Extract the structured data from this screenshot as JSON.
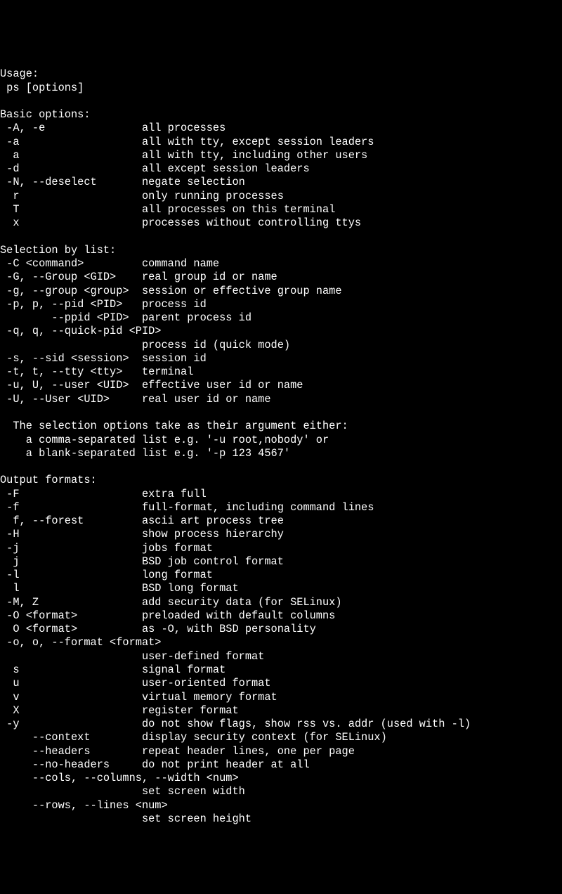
{
  "lines": [
    "Usage:",
    " ps [options]",
    "",
    "Basic options:",
    " -A, -e               all processes",
    " -a                   all with tty, except session leaders",
    "  a                   all with tty, including other users",
    " -d                   all except session leaders",
    " -N, --deselect       negate selection",
    "  r                   only running processes",
    "  T                   all processes on this terminal",
    "  x                   processes without controlling ttys",
    "",
    "Selection by list:",
    " -C <command>         command name",
    " -G, --Group <GID>    real group id or name",
    " -g, --group <group>  session or effective group name",
    " -p, p, --pid <PID>   process id",
    "        --ppid <PID>  parent process id",
    " -q, q, --quick-pid <PID>",
    "                      process id (quick mode)",
    " -s, --sid <session>  session id",
    " -t, t, --tty <tty>   terminal",
    " -u, U, --user <UID>  effective user id or name",
    " -U, --User <UID>     real user id or name",
    "",
    "  The selection options take as their argument either:",
    "    a comma-separated list e.g. '-u root,nobody' or",
    "    a blank-separated list e.g. '-p 123 4567'",
    "",
    "Output formats:",
    " -F                   extra full",
    " -f                   full-format, including command lines",
    "  f, --forest         ascii art process tree",
    " -H                   show process hierarchy",
    " -j                   jobs format",
    "  j                   BSD job control format",
    " -l                   long format",
    "  l                   BSD long format",
    " -M, Z                add security data (for SELinux)",
    " -O <format>          preloaded with default columns",
    "  O <format>          as -O, with BSD personality",
    " -o, o, --format <format>",
    "                      user-defined format",
    "  s                   signal format",
    "  u                   user-oriented format",
    "  v                   virtual memory format",
    "  X                   register format",
    " -y                   do not show flags, show rss vs. addr (used with -l)",
    "     --context        display security context (for SELinux)",
    "     --headers        repeat header lines, one per page",
    "     --no-headers     do not print header at all",
    "     --cols, --columns, --width <num>",
    "                      set screen width",
    "     --rows, --lines <num>",
    "                      set screen height"
  ]
}
